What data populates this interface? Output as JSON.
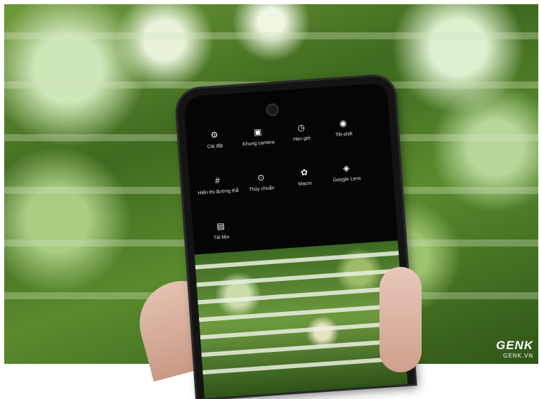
{
  "menu": {
    "items": [
      {
        "label": "Cài đặt",
        "icon": "gear-icon"
      },
      {
        "label": "Khung camera",
        "icon": "frame-icon"
      },
      {
        "label": "Hẹn giờ",
        "icon": "timer-icon"
      },
      {
        "label": "Tilt-shift",
        "icon": "tilt-shift-icon"
      },
      {
        "label": "Hiển thị đường thẳ",
        "icon": "grid-icon"
      },
      {
        "label": "Thủy chuẩn",
        "icon": "level-icon"
      },
      {
        "label": "Macro",
        "icon": "macro-icon"
      },
      {
        "label": "Google Lens",
        "icon": "lens-icon"
      },
      {
        "label": "Tài liệu",
        "icon": "document-icon"
      }
    ]
  },
  "watermark": {
    "logo": "GENK",
    "site": "GENK.VN"
  },
  "colors": {
    "foliage": "#4f7d27",
    "phone_body": "#141414",
    "screen": "#050505"
  }
}
